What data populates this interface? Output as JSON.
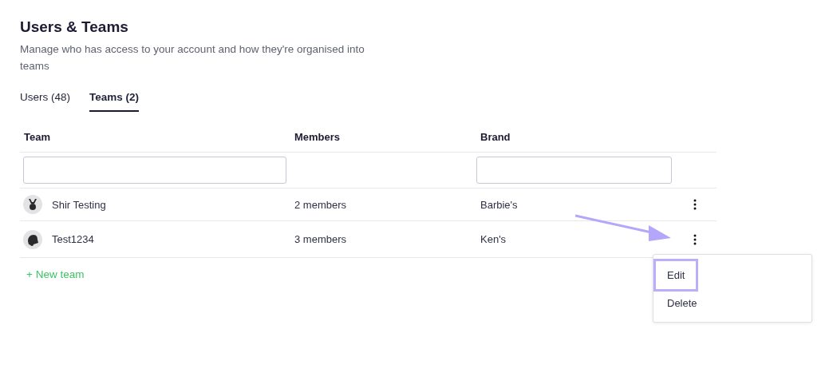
{
  "header": {
    "title": "Users & Teams",
    "description": "Manage who has access to your account and how they're organised into teams"
  },
  "tabs": [
    {
      "label": "Users (48)",
      "selected": false
    },
    {
      "label": "Teams (2)",
      "selected": true
    }
  ],
  "table": {
    "columns": [
      "Team",
      "Members",
      "Brand"
    ],
    "rows": [
      {
        "kind": "medal",
        "team": "Shir Testing",
        "members": "2 members",
        "brand": "Barbie's",
        "pointed": false,
        "menu_open": false
      },
      {
        "kind": "bell",
        "team": "Test1234",
        "members": "3 members",
        "brand": "Ken's",
        "pointed": true,
        "menu_open": true
      }
    ],
    "menu": [
      {
        "label": "Edit",
        "highlighted": true
      },
      {
        "label": "Delete",
        "highlighted": false
      }
    ]
  },
  "new_team": "+ New team"
}
